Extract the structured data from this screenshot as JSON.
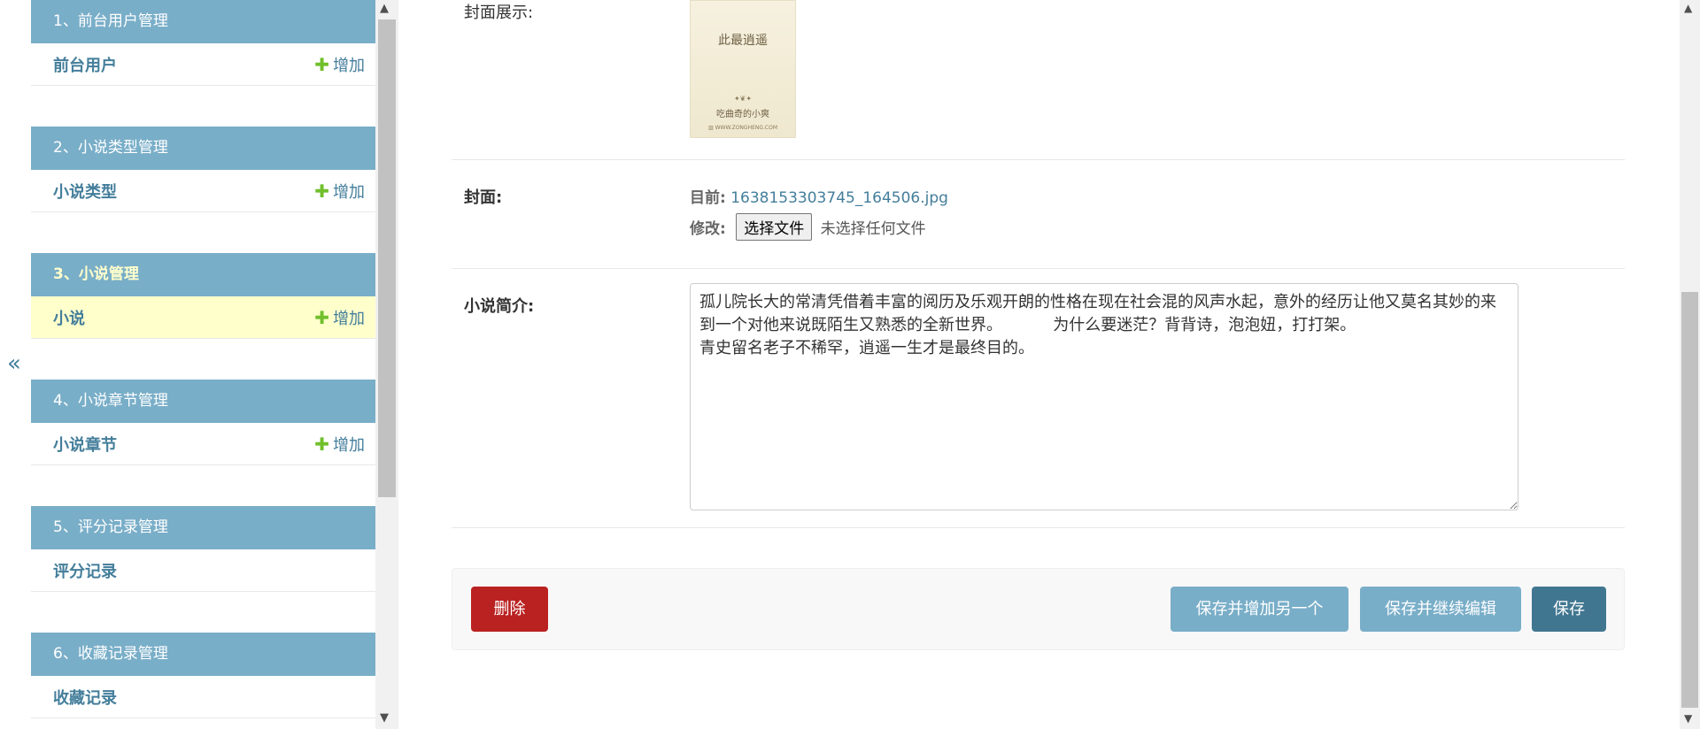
{
  "sidebar": {
    "collapse_label": "«",
    "modules": [
      {
        "caption": "1、前台用户管理",
        "model": "前台用户",
        "add": "增加",
        "current": false
      },
      {
        "caption": "2、小说类型管理",
        "model": "小说类型",
        "add": "增加",
        "current": false
      },
      {
        "caption": "3、小说管理",
        "model": "小说",
        "add": "增加",
        "current": true
      },
      {
        "caption": "4、小说章节管理",
        "model": "小说章节",
        "add": "增加",
        "current": false
      },
      {
        "caption": "5、评分记录管理",
        "model": "评分记录",
        "add": "",
        "current": false
      },
      {
        "caption": "6、收藏记录管理",
        "model": "收藏记录",
        "add": "",
        "current": false
      }
    ]
  },
  "form": {
    "cover_display_label": "封面展示:",
    "cover_image": {
      "title": "此最逍遥",
      "ornament": "✦❦✦",
      "author": "吃曲奇的小爽",
      "site": "▥ WWW.ZONGHENG.COM"
    },
    "cover_label": "封面:",
    "current_label": "目前:",
    "current_file": "1638153303745_164506.jpg",
    "change_label": "修改:",
    "choose_file_button": "选择文件",
    "no_file_text": "未选择任何文件",
    "description_label": "小说简介:",
    "description_value": "孤儿院长大的常清凭借着丰富的阅历及乐观开朗的性格在现在社会混的风声水起，意外的经历让他又莫名其妙的来到一个对他来说既陌生又熟悉的全新世界。          为什么要迷茫？背背诗，泡泡妞，打打架。\n青史留名老子不稀罕，逍遥一生才是最终目的。"
  },
  "actions": {
    "delete": "删除",
    "save_add_another": "保存并增加另一个",
    "save_continue": "保存并继续编辑",
    "save": "保存"
  },
  "colors": {
    "module_header": "#79aec8",
    "link": "#447e9b",
    "add_plus": "#70bf2b",
    "current_row": "#ffffcc",
    "delete_button": "#ba2121",
    "save_button": "#417690"
  }
}
